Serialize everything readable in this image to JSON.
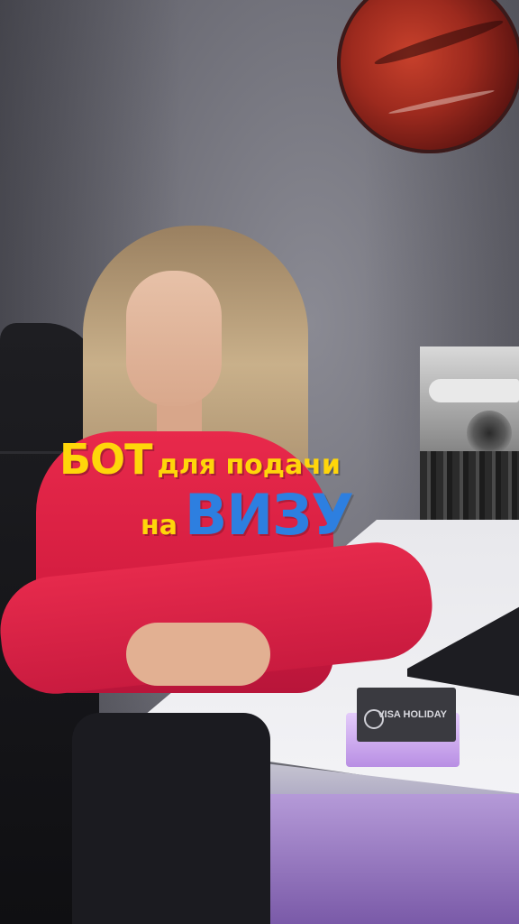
{
  "caption": {
    "word_bot": "БОТ",
    "phrase_for_filing": "для подачи",
    "word_on": "на",
    "word_visa": "ВИЗУ"
  },
  "card_holder": {
    "brand": "VISA HOLIDAY"
  },
  "colors": {
    "caption_yellow": "#ffd60a",
    "caption_blue": "#2d7fe0",
    "sweater_red": "#e8294b"
  }
}
